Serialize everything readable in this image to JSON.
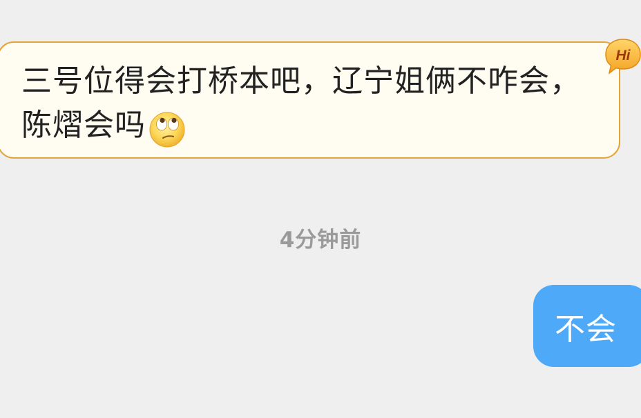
{
  "incoming": {
    "text": "三号位得会打桥本吧，辽宁姐俩不咋会，陈熠会吗",
    "emoji": "face-with-rolling-eyes",
    "badge_icon": "hi-speech-badge",
    "bubble_bg": "#fffcf1",
    "bubble_border": "#e3a43a"
  },
  "divider": {
    "timestamp": "4分钟前"
  },
  "outgoing": {
    "text": "不会",
    "bubble_bg": "#4eaaf9"
  }
}
